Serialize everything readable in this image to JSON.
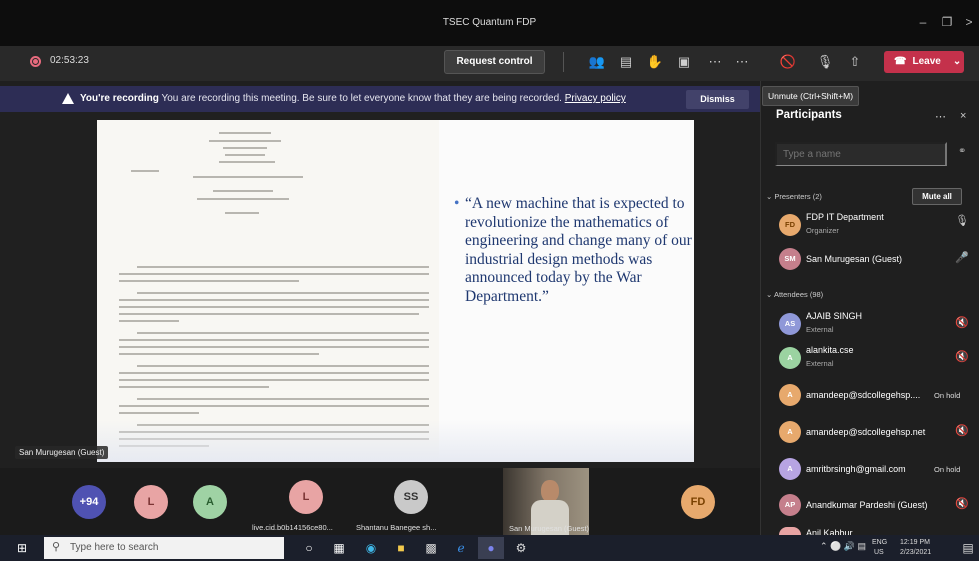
{
  "window": {
    "title": "TSEC Quantum FDP"
  },
  "toolbar": {
    "timer": "02:53:23",
    "request_control": "Request control",
    "leave_label": "Leave"
  },
  "recording_banner": {
    "title": "You're recording",
    "message": "You are recording this meeting. Be sure to let everyone know that they are being recorded.",
    "link": "Privacy policy",
    "dismiss": "Dismiss"
  },
  "tooltip": "Unmute (Ctrl+Shift+M)",
  "slide": {
    "quote": "“A new machine that is expected to revolutionize the mathematics of engineering and change many of our industrial design methods was announced today by the War Department.”"
  },
  "stage": {
    "presenter_label": "San Murugesan (Guest)"
  },
  "gallery": {
    "count_badge": "+94",
    "tiles": [
      {
        "initials": "L",
        "color": "#e8a4a4"
      },
      {
        "initials": "A",
        "color": "#9fd2a4"
      },
      {
        "initials": "L",
        "color": "#e8a4a4"
      },
      {
        "initials": "SS",
        "color": "#c9c9c9"
      },
      {
        "initials": "FD",
        "color": "#e7a96d"
      }
    ],
    "labels": [
      "live.cid.b0b14156ce80...",
      "Shantanu Banegee sh...",
      "San Murugesan (Guest)"
    ]
  },
  "participants": {
    "title": "Participants",
    "search_placeholder": "Type a name",
    "presenters_header": "Presenters (2)",
    "mute_all": "Mute all",
    "attendees_header": "Attendees (98)",
    "presenters": [
      {
        "initials": "FD",
        "name": "FDP IT Department",
        "sub": "Organizer",
        "color": "#e7a96d"
      },
      {
        "initials": "SM",
        "name": "San Murugesan (Guest)",
        "sub": "",
        "color": "#c57f8c"
      }
    ],
    "attendees": [
      {
        "initials": "AS",
        "name": "AJAIB SINGH",
        "sub": "External",
        "status": "",
        "color": "#8f98d8"
      },
      {
        "initials": "A",
        "name": "alankita.cse",
        "sub": "External",
        "status": "",
        "color": "#9bd3a1"
      },
      {
        "initials": "A",
        "name": "amandeep@sdcollegehsp....",
        "sub": "",
        "status": "On hold",
        "color": "#e7a96d"
      },
      {
        "initials": "A",
        "name": "amandeep@sdcollegehsp.net",
        "sub": "",
        "status": "",
        "color": "#e7a96d"
      },
      {
        "initials": "A",
        "name": "amritbrsingh@gmail.com",
        "sub": "",
        "status": "On hold",
        "color": "#b7a4e3"
      },
      {
        "initials": "AP",
        "name": "Anandkumar Pardeshi (Guest)",
        "sub": "",
        "status": "",
        "color": "#c57f8c"
      },
      {
        "initials": "",
        "name": "Anil Kabbur",
        "sub": "",
        "status": "",
        "color": "#e8a4a4"
      }
    ]
  },
  "taskbar": {
    "search_placeholder": "Type here to search",
    "lang": "ENG",
    "region": "US",
    "time": "12:19 PM",
    "date": "2/23/2021"
  }
}
